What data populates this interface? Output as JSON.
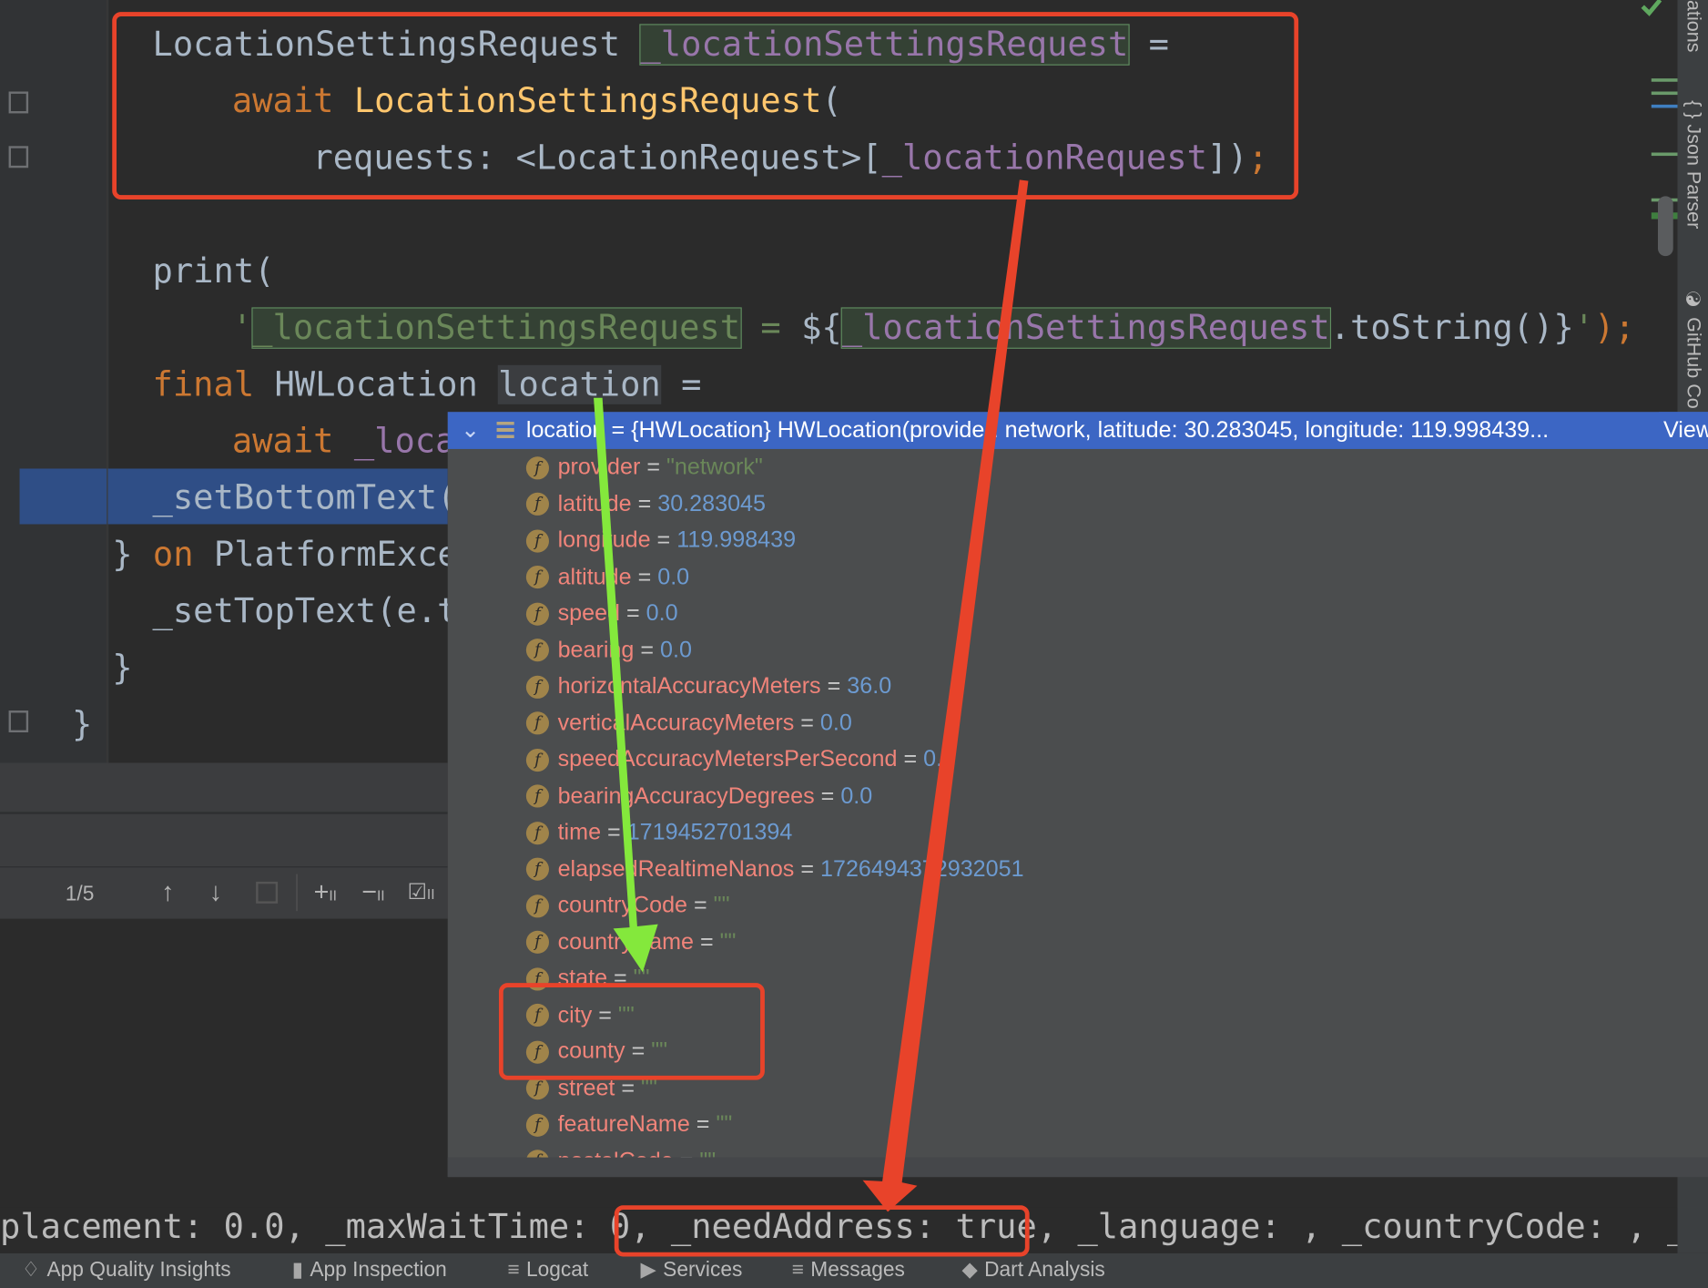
{
  "editor": {
    "lines": [
      [
        {
          "t": "LocationSettingsRequest ",
          "k": "id"
        },
        {
          "t": "_locationSettingsRequest",
          "k": "fld hl-green"
        },
        {
          "t": " =",
          "k": "id"
        }
      ],
      [
        {
          "t": "await ",
          "k": "kw"
        },
        {
          "t": "LocationSettingsRequest",
          "k": "cls"
        },
        {
          "t": "(",
          "k": "id"
        }
      ],
      [
        {
          "t": "requests: <LocationRequest>[",
          "k": "id"
        },
        {
          "t": "_locationRequest",
          "k": "fld"
        },
        {
          "t": "])",
          "k": "id"
        },
        {
          "t": ";",
          "k": "punc"
        }
      ],
      [],
      [
        {
          "t": "print(",
          "k": "id"
        }
      ],
      [
        {
          "t": "'",
          "k": "str"
        },
        {
          "t": "_locationSettingsRequest",
          "k": "str hl-green"
        },
        {
          "t": " = ",
          "k": "str"
        },
        {
          "t": "${",
          "k": "id"
        },
        {
          "t": "_locationSettingsRequest",
          "k": "fld hl-green"
        },
        {
          "t": ".toString()}",
          "k": "id"
        },
        {
          "t": "'",
          "k": "str"
        },
        {
          "t": ");",
          "k": "punc"
        }
      ],
      [
        {
          "t": "final ",
          "k": "kw"
        },
        {
          "t": "HWLocation ",
          "k": "id"
        },
        {
          "t": "location",
          "k": "id hl-gray"
        },
        {
          "t": " =",
          "k": "id"
        }
      ],
      [
        {
          "t": "await ",
          "k": "kw"
        },
        {
          "t": "_loca",
          "k": "fld"
        }
      ],
      [
        {
          "t": "_setBottomText(",
          "k": "id"
        }
      ],
      [
        {
          "t": "} ",
          "k": "id"
        },
        {
          "t": "on ",
          "k": "kw"
        },
        {
          "t": "PlatformExce",
          "k": "id"
        }
      ],
      [
        {
          "t": "_setTopText(e.t",
          "k": "id"
        }
      ],
      [
        {
          "t": "}",
          "k": "id"
        }
      ],
      [
        {
          "t": "}",
          "k": "id"
        }
      ]
    ]
  },
  "debug_popup": {
    "header": "location = {HWLocation} HWLocation(provider: network, latitude: 30.283045, longitude: 119.998439...",
    "view_link": "View",
    "fields": [
      {
        "name": "provider",
        "value": "\"network\"",
        "type": "string"
      },
      {
        "name": "latitude",
        "value": "30.283045",
        "type": "number"
      },
      {
        "name": "longitude",
        "value": "119.998439",
        "type": "number"
      },
      {
        "name": "altitude",
        "value": "0.0",
        "type": "number"
      },
      {
        "name": "speed",
        "value": "0.0",
        "type": "number"
      },
      {
        "name": "bearing",
        "value": "0.0",
        "type": "number"
      },
      {
        "name": "horizontalAccuracyMeters",
        "value": "36.0",
        "type": "number"
      },
      {
        "name": "verticalAccuracyMeters",
        "value": "0.0",
        "type": "number"
      },
      {
        "name": "speedAccuracyMetersPerSecond",
        "value": "0.0",
        "type": "number"
      },
      {
        "name": "bearingAccuracyDegrees",
        "value": "0.0",
        "type": "number"
      },
      {
        "name": "time",
        "value": "1719452701394",
        "type": "number"
      },
      {
        "name": "elapsedRealtimeNanos",
        "value": "1726494372932051",
        "type": "number"
      },
      {
        "name": "countryCode",
        "value": "\"\"",
        "type": "string"
      },
      {
        "name": "countryName",
        "value": "\"\"",
        "type": "string"
      },
      {
        "name": "state",
        "value": "\"\"",
        "type": "string"
      },
      {
        "name": "city",
        "value": "\"\"",
        "type": "string"
      },
      {
        "name": "county",
        "value": "\"\"",
        "type": "string"
      },
      {
        "name": "street",
        "value": "\"\"",
        "type": "string"
      },
      {
        "name": "featureName",
        "value": "\"\"",
        "type": "string"
      },
      {
        "name": "postalCode",
        "value": "\"\"",
        "type": "string"
      }
    ]
  },
  "debug_toolbar": {
    "counter": "1/5"
  },
  "console": {
    "text": "placement: 0.0, _maxWaitTime: 0, _needAddress: true, _language: , _countryCode: , _e"
  },
  "right_tabs": [
    "ations",
    "Json Parser",
    "GitHub Co"
  ],
  "status_bar": {
    "items": [
      {
        "label": "App Quality Insights",
        "icon": "diamond-icon"
      },
      {
        "label": "App Inspection",
        "icon": "inspection-icon"
      },
      {
        "label": "Logcat",
        "icon": "logcat-icon"
      },
      {
        "label": "Services",
        "icon": "services-icon"
      },
      {
        "label": "Messages",
        "icon": "messages-icon"
      },
      {
        "label": "Dart Analysis",
        "icon": "dart-icon"
      }
    ]
  },
  "annotation_colors": {
    "red": "#e8432a",
    "green": "#84e83c"
  }
}
